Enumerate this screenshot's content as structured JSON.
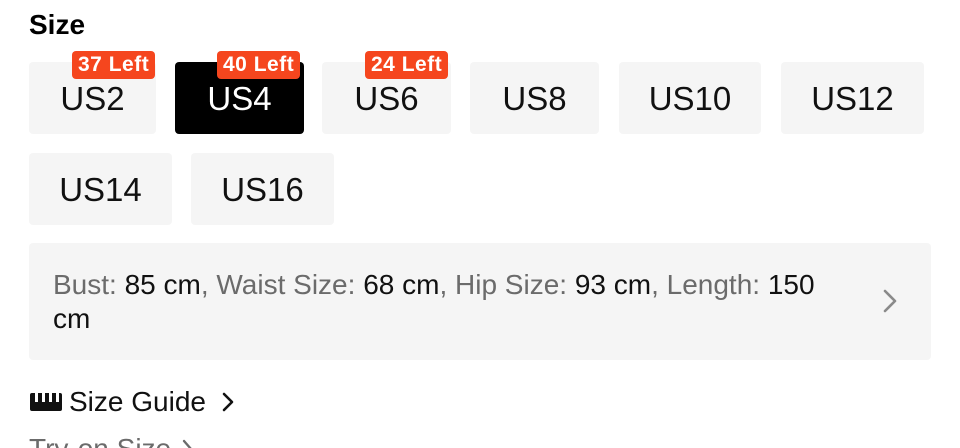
{
  "section": {
    "title": "Size"
  },
  "sizes": [
    {
      "label": "US2",
      "badge": "37 Left",
      "selected": false
    },
    {
      "label": "US4",
      "badge": "40 Left",
      "selected": true
    },
    {
      "label": "US6",
      "badge": "24 Left",
      "selected": false
    },
    {
      "label": "US8",
      "badge": "",
      "selected": false
    },
    {
      "label": "US10",
      "badge": "",
      "selected": false
    },
    {
      "label": "US12",
      "badge": "",
      "selected": false
    },
    {
      "label": "US14",
      "badge": "",
      "selected": false
    },
    {
      "label": "US16",
      "badge": "",
      "selected": false
    }
  ],
  "measurements": {
    "bust_label": "Bust: ",
    "bust_value": "85 cm",
    "waist_label": "Waist Size: ",
    "waist_value": "68 cm",
    "hip_label": "Hip Size: ",
    "hip_value": "93 cm",
    "length_label": "Length: ",
    "length_value": "150 cm",
    "separator": ", "
  },
  "size_guide": {
    "label": "Size Guide"
  },
  "partial_link": {
    "label": "Try-on Size"
  },
  "colors": {
    "badge": "#f5461e",
    "selected": "#000000",
    "button_bg": "#f5f5f5"
  }
}
